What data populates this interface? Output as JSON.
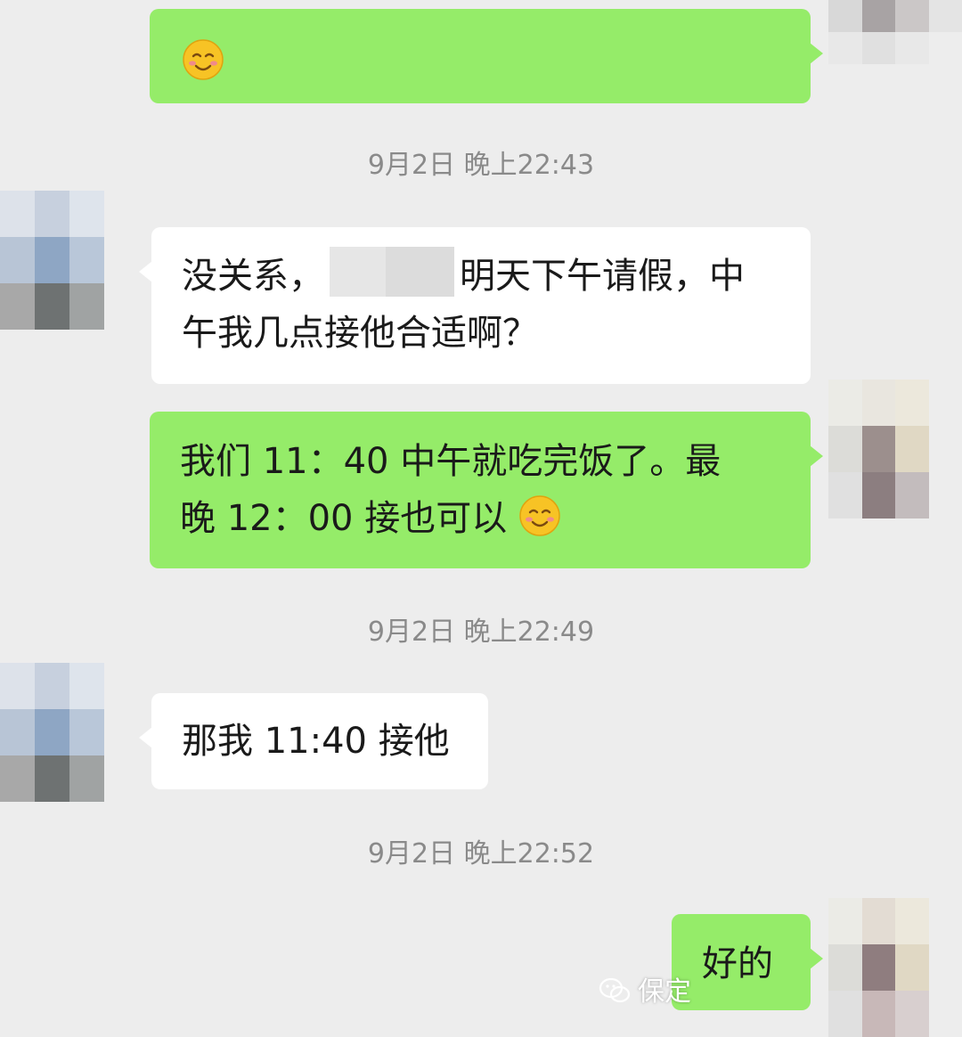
{
  "messages": [
    {
      "type": "out",
      "text": "",
      "emoji": "smile-emoji"
    },
    {
      "type": "timestamp",
      "text": "9月2日 晚上22:43"
    },
    {
      "type": "in",
      "text_before": "没关系，",
      "text_after": "明天下午请假，中",
      "line2": "午我几点接他合适啊？"
    },
    {
      "type": "out",
      "line1": "我们 11：40 中午就吃完饭了。最",
      "line2": "晚 12：00 接也可以",
      "emoji": "smile-emoji"
    },
    {
      "type": "timestamp",
      "text": "9月2日 晚上22:49"
    },
    {
      "type": "in",
      "text": "那我 11:40 接他"
    },
    {
      "type": "timestamp",
      "text": "9月2日 晚上22:52"
    },
    {
      "type": "out",
      "text": "好的"
    }
  ],
  "watermark": {
    "text": "保定"
  },
  "colors": {
    "background": "#ededed",
    "outgoing_bubble": "#95ec69",
    "incoming_bubble": "#ffffff",
    "timestamp_text": "#8a8a8a"
  }
}
